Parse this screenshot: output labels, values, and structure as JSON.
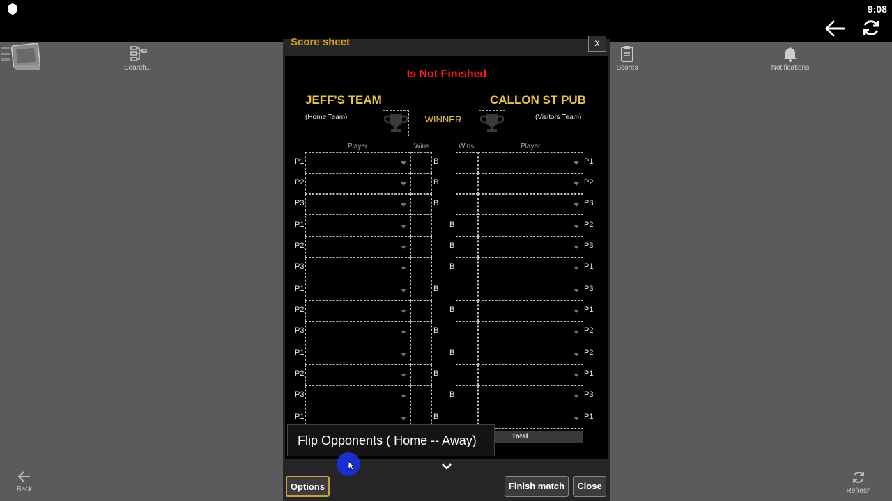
{
  "status_bar": {
    "time": "9:08"
  },
  "topbar": {
    "search_label": "Search...",
    "scores_label": "Scores",
    "notifications_label": "Notifications"
  },
  "bottombar": {
    "back_label": "Back",
    "refresh_label": "Refresh"
  },
  "dialog": {
    "title": "Score sheet",
    "close_x": "x",
    "status": "Is Not Finished",
    "home_team": {
      "name": "JEFF'S TEAM",
      "role": "(Home Team)"
    },
    "visitor_team": {
      "name": "CALLON ST PUB",
      "role": "(Visitors Team)"
    },
    "winner_label": "WINNER",
    "headers": {
      "player_left": "Player",
      "wins_left": "Wins",
      "wins_right": "Wins",
      "player_right": "Player"
    },
    "rows": [
      {
        "left": "P1",
        "b_side": "left",
        "b": "B",
        "right": "P1"
      },
      {
        "left": "P2",
        "b_side": "left",
        "b": "B",
        "right": "P2"
      },
      {
        "left": "P3",
        "b_side": "left",
        "b": "B",
        "right": "P3"
      },
      {
        "left": "P1",
        "b_side": "right",
        "b": "B",
        "right": "P2"
      },
      {
        "left": "P2",
        "b_side": "right",
        "b": "B",
        "right": "P3"
      },
      {
        "left": "P3",
        "b_side": "right",
        "b": "B",
        "right": "P1"
      },
      {
        "left": "P1",
        "b_side": "left",
        "b": "B",
        "right": "P3"
      },
      {
        "left": "P2",
        "b_side": "right",
        "b": "B",
        "right": "P1"
      },
      {
        "left": "P3",
        "b_side": "left",
        "b": "B",
        "right": "P2"
      },
      {
        "left": "P1",
        "b_side": "right",
        "b": "B",
        "right": "P2"
      },
      {
        "left": "P2",
        "b_side": "left",
        "b": "B",
        "right": "P1"
      },
      {
        "left": "P3",
        "b_side": "right",
        "b": "B",
        "right": "P3"
      },
      {
        "left": "P1",
        "b_side": "left",
        "b": "B",
        "right": "P1"
      }
    ],
    "total_label": "Total",
    "tooltip": "Flip Opponents ( Home -- Away)",
    "buttons": {
      "options": "Options",
      "finish": "Finish match",
      "close": "Close"
    }
  },
  "colors": {
    "accent": "#e8c547",
    "status_red": "#ff1a1a",
    "cursor_blue": "#1a2fd0"
  }
}
